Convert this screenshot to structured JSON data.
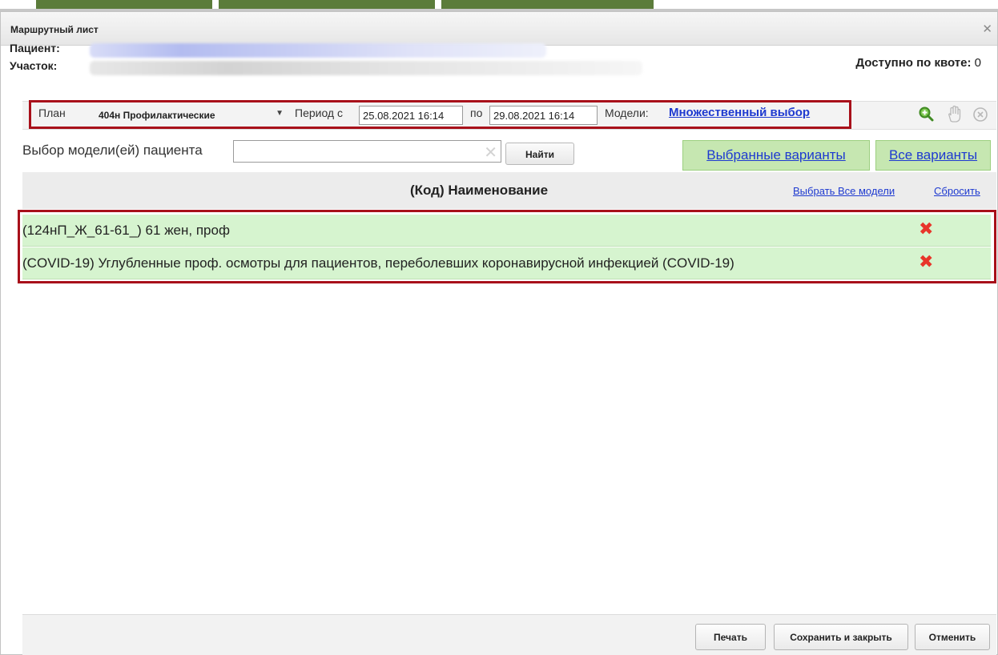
{
  "top_tabs": {
    "items": [
      "",
      ""
    ]
  },
  "dialog": {
    "title": "Маршрутный лист",
    "close_glyph": "✕"
  },
  "patient": {
    "patient_label": "Пациент:",
    "district_label": "Участок:",
    "quota_label": "Доступно по квоте:",
    "quota_value": "0"
  },
  "filter": {
    "plan_label": "План",
    "plan_value": "404н Профилактические",
    "period_from_label": "Период с",
    "period_from": "25.08.2021 16:14",
    "period_to_label": "по",
    "period_to": "29.08.2021 16:14",
    "models_label": "Модели:",
    "models_value": "Множественный выбор",
    "icons": [
      "search-zoom-icon",
      "hand-icon",
      "clear-circle-icon"
    ]
  },
  "search": {
    "label": "Выбор модели(ей) пациента",
    "value": "",
    "find_button": "Найти",
    "selected_variants": "Выбранные варианты",
    "all_variants": "Все варианты"
  },
  "grid": {
    "header": "(Код) Наименование",
    "select_all": "Выбрать Все модели",
    "reset": "Сбросить",
    "rows": [
      {
        "text": "(124нП_Ж_61-61_) 61 жен, проф"
      },
      {
        "text": "(COVID-19) Углубленные проф. осмотры для пациентов, переболевших коронавирусной инфекцией (COVID-19)"
      }
    ]
  },
  "footer": {
    "print": "Печать",
    "save_close": "Сохранить и закрыть",
    "cancel": "Отменить"
  },
  "colors": {
    "accent_link": "#1e3ad0",
    "row_bg": "#d6f4cf",
    "highlight_border": "#a8101a",
    "delete_icon": "#e8352a"
  }
}
